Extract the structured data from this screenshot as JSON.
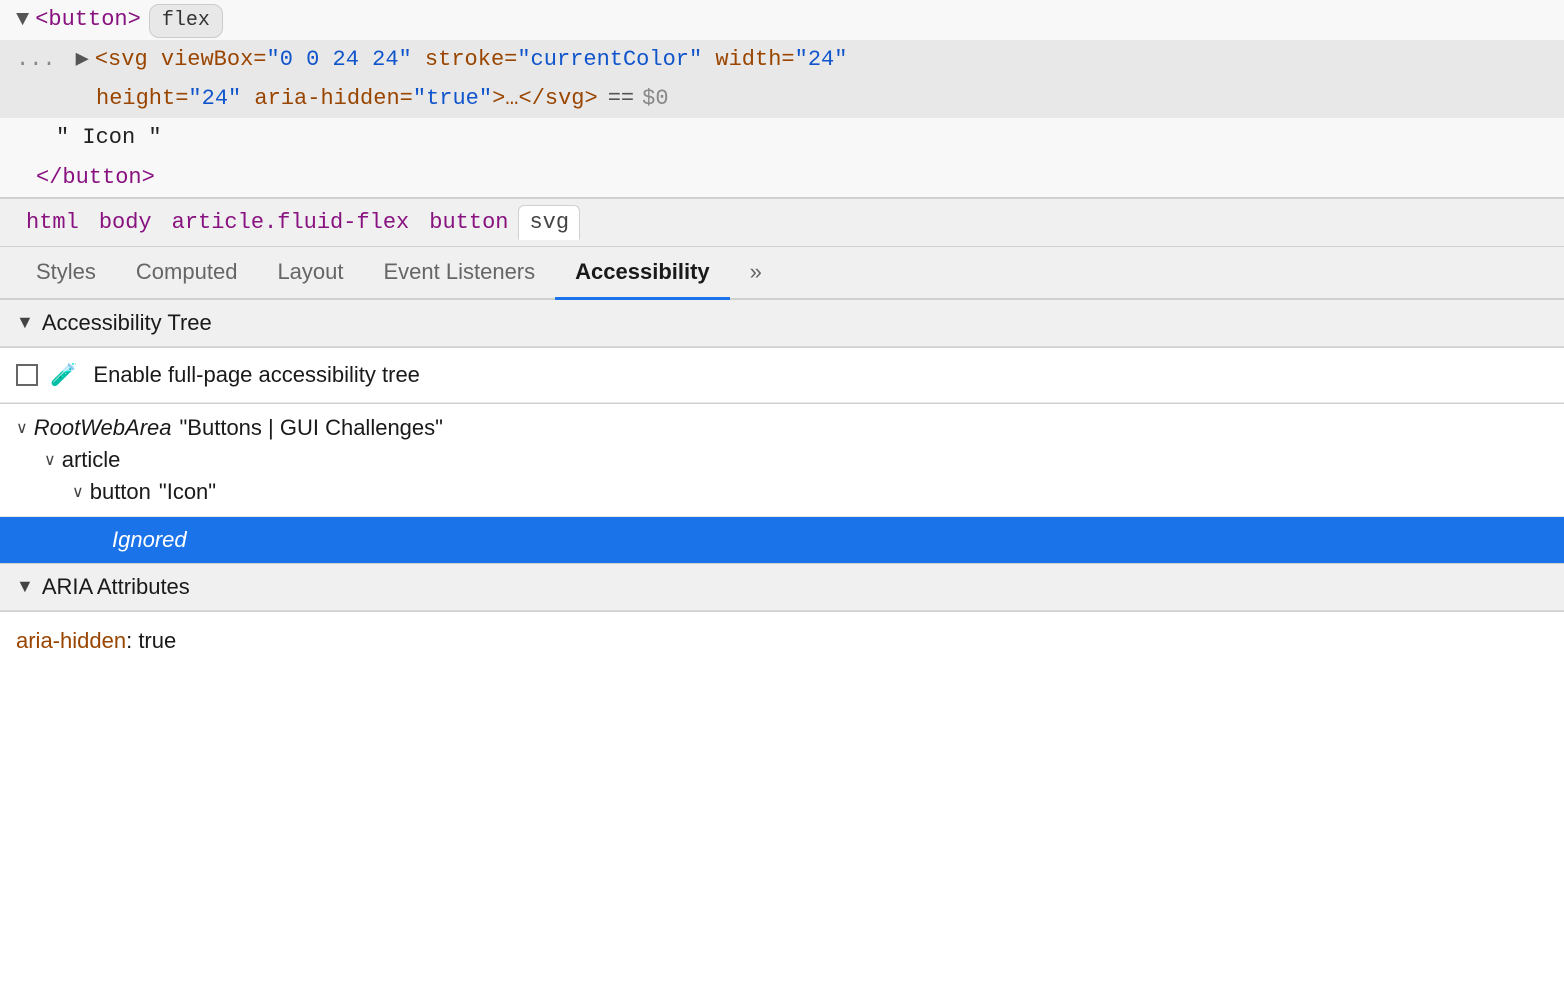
{
  "htmlPanel": {
    "line1": {
      "arrow": "▼",
      "content_purple1": "<button>",
      "badge": "flex"
    },
    "line2": {
      "dots": "...",
      "arrow": "▶",
      "content_brown": "<svg viewBox=\"0 0 24 24\" stroke=\"currentColor\" width=\"24\""
    },
    "line3": {
      "content_brown": "height=\"24\" aria-hidden=\"true\">…</svg>",
      "equals": "==",
      "dollar": "$0"
    },
    "line4": {
      "text": "\" Icon \""
    },
    "line5": {
      "content_purple": "</button>"
    }
  },
  "breadcrumb": {
    "items": [
      "html",
      "body",
      "article.fluid-flex",
      "button",
      "svg"
    ]
  },
  "tabs": {
    "items": [
      "Styles",
      "Computed",
      "Layout",
      "Event Listeners",
      "Accessibility",
      "»"
    ],
    "active": "Accessibility"
  },
  "accessibilityTree": {
    "sectionHeader": "Accessibility Tree",
    "checkboxLabel": "Enable full-page accessibility tree",
    "rootNode": {
      "label": "RootWebArea",
      "value": "\"Buttons | GUI Challenges\""
    },
    "articleNode": {
      "label": "article"
    },
    "buttonNode": {
      "label": "button",
      "value": "\"Icon\""
    },
    "ignoredNode": {
      "label": "Ignored"
    }
  },
  "ariaSection": {
    "header": "ARIA Attributes",
    "attr": {
      "name": "aria-hidden",
      "colon": ":",
      "value": "true"
    }
  }
}
